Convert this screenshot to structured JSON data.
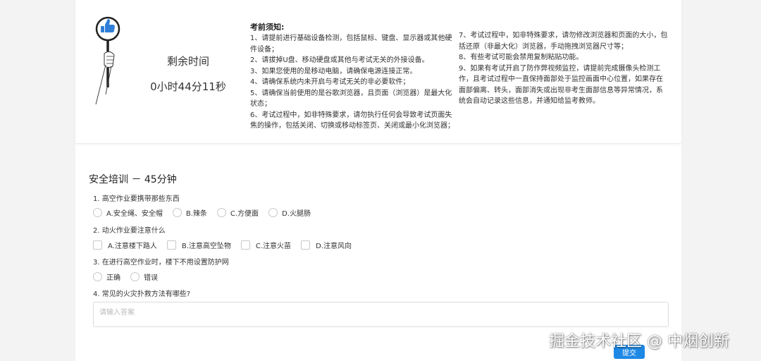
{
  "timer": {
    "label": "剩余时间",
    "value": "0小时44分11秒"
  },
  "notice": {
    "title": "考前须知:",
    "left_items": [
      "1、请提前进行基础设备检测，包括鼠标、键盘、显示器或其他硬件设备；",
      "2、请拔掉U盘、移动硬盘或其他与考试无关的外接设备。",
      "3、如果您使用的是移动电脑，请确保电源连接正常。",
      "4、请确保系统内未开启与考试无关的非必要软件；",
      "5、请确保当前使用的是谷歌浏览器，且页面（浏览器）是最大化状态；",
      "6、考试过程中，如非特殊要求，请勿执行任何会导致考试页面失焦的操作，包括关闭、切换或移动标签页、关闭或最小化浏览器；"
    ],
    "right_items": [
      "7、考试过程中，如非特殊要求，请勿修改浏览器和页面的大小，包括还原（非最大化）浏览器，手动拖拽浏览器尺寸等；",
      "8、有些考试可能会禁用复制粘贴功能。",
      "9、如果有考试开启了防作弊视频监控，请提前完成摄像头检测工作，且考试过程中一直保持面部处于监控画面中心位置，如果存在面部偏离、转头，面部消失或出现非考生面部信息等异常情况，系统会自动记录这些信息，并通知给监考教师。"
    ]
  },
  "exam": {
    "title": "安全培训  －  45分钟",
    "q1": {
      "text": "1. 高空作业要携带那些东西",
      "options": [
        "A.安全绳、安全帽",
        "B.辣条",
        "C.方便面",
        "D.火腿肠"
      ]
    },
    "q2": {
      "text": "2. 动火作业要注意什么",
      "options": [
        "A.注意楼下路人",
        "B.注意高空坠物",
        "C.注意火苗",
        "D.注意风向"
      ]
    },
    "q3": {
      "text": "3. 在进行高空作业时，楼下不用设置防护网",
      "options": [
        "正确",
        "错误"
      ]
    },
    "q4": {
      "text": "4. 常见的火灾扑救方法有哪些?",
      "placeholder": "请输入答案"
    },
    "submit_label": "提交"
  },
  "watermark": "掘金技术社区 @ 中烟创新",
  "icons": {
    "mascot": "thumbs-up-sign-icon"
  },
  "colors": {
    "accent": "#1e88e5"
  }
}
